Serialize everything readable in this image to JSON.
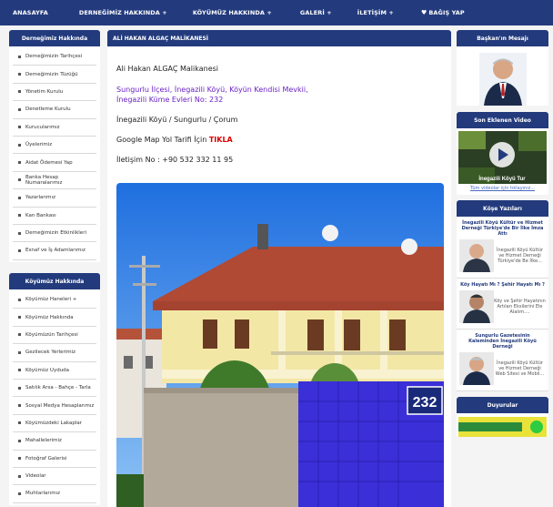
{
  "topnav": {
    "items": [
      {
        "label": "ANASAYFA"
      },
      {
        "label": "DERNEĞİMİZ HAKKINDA +"
      },
      {
        "label": "KÖYÜMÜZ HAKKINDA +"
      },
      {
        "label": "GALERİ +"
      },
      {
        "label": "İLETİŞİM +"
      },
      {
        "label": "BAĞIŞ YAP"
      }
    ]
  },
  "left1": {
    "title": "Derneğimiz Hakkında",
    "items": [
      "Derneğimizin Tarihçesi",
      "Derneğimizin Tüzüğü",
      "Yönetim Kurulu",
      "Denetleme Kurulu",
      "Kurucularımız",
      "Üyelerimiz",
      "Aidat Ödemesi Yap",
      "Banka Hesap Numaralarımız",
      "Yazarlarımız",
      "Kan Bankası",
      "Derneğimizin Etkinlikleri",
      "Esnaf ve İş Adamlarımız"
    ]
  },
  "left2": {
    "title": "Köyümüz Hakkında",
    "items": [
      "Köyümüz Haneleri +",
      "Köyümüz Hakkında",
      "Köyümüzün Tarihçesi",
      "Gezilecek Yerlerimiz",
      "Köyümüz Uyduda",
      "Satılık Arsa - Bahçe - Tarla",
      "Sosyal Medya Hesaplarımız",
      "Köyümüzdeki Lakaplar",
      "Mahallelerimiz",
      "Fotoğraf Galerisi",
      "Videolar",
      "Muhtarlarımız"
    ]
  },
  "main": {
    "title": "ALİ HAKAN ALGAÇ MALİKANESİ",
    "name": "Ali Hakan ALGAÇ Malikanesi",
    "address_line1": "Sungurlu İlçesi, İnegazili Köyü, Köyün Kendisi Mevkii,",
    "address_line2": "İnegazili Küme Evleri No: 232",
    "location": "İnegazili Köyü / Sungurlu / Çorum",
    "map_text": "Google Map Yol Tarifi İçin ",
    "map_link": "TIKLA",
    "contact": "İletişim No : +90 532 332 11 95",
    "house_number": "232"
  },
  "right": {
    "president_title": "Başkan'ın Mesajı",
    "video_title": "Son Eklenen Video",
    "video_caption": "İnegazili Köyü Tur",
    "video_link": "Tüm videolar için tıklayınız...",
    "columns_title": "Köşe Yazıları",
    "columns": [
      {
        "title": "İnegazili Köyü Kültür ve Hizmet Derneği Türkiye'de Bir İlke İmza Attı",
        "desc": "İnegazili Köyü Kültür ve Hizmet Derneği Türkiye'de Be İlke..."
      },
      {
        "title": "Köy Hayatı Mı ? Şehir Hayatı Mı ?",
        "desc": "Köy ve Şehir Hayatının Artıları Eksilerini Ele Alalım...."
      },
      {
        "title": "Sungurlu Gazetesinin Kaleminden İnegazili Köyü Derneği",
        "desc": "İnegazili Köyü Kültür ve Hizmet Derneği Web Sitesi ve Mobil..."
      }
    ],
    "announcements_title": "Duyurular"
  },
  "colors": {
    "navy": "#233b7d",
    "purple_text": "#6a22c4",
    "link_red": "#dd0000"
  }
}
